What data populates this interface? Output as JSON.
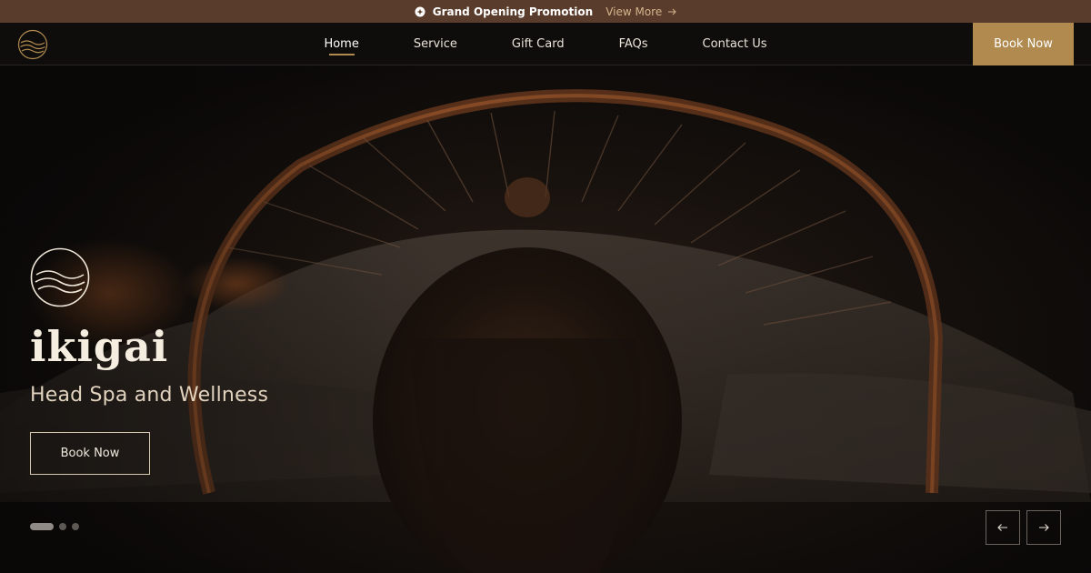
{
  "promo": {
    "title": "Grand Opening Promotion",
    "link_label": "View More",
    "badge_icon": "sparkle-badge-icon",
    "arrow_icon": "arrow-right-icon"
  },
  "header": {
    "logo_icon": "wave-circle-logo-icon",
    "nav": [
      {
        "label": "Home",
        "active": true
      },
      {
        "label": "Service",
        "active": false
      },
      {
        "label": "Gift Card",
        "active": false
      },
      {
        "label": "FAQs",
        "active": false
      },
      {
        "label": "Contact Us",
        "active": false
      }
    ],
    "book_label": "Book Now"
  },
  "hero": {
    "logo_icon": "wave-circle-logo-icon",
    "title": "ikigai",
    "subtitle": "Head Spa and Wellness",
    "button_label": "Book Now",
    "slides": 3,
    "active_slide": 1,
    "prev_icon": "arrow-left-icon",
    "next_icon": "arrow-right-icon"
  },
  "colors": {
    "promo_bg": "#5a3c2c",
    "accent_gold": "#b08a4f",
    "link_gold": "#d2b48c",
    "header_bg": "#0f0d0c"
  }
}
